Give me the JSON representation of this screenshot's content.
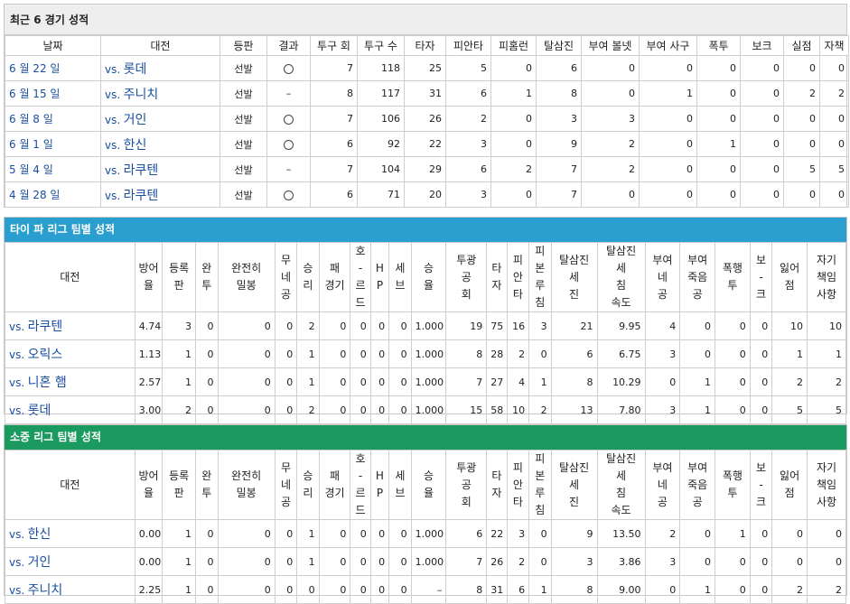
{
  "recent": {
    "title": "최근 6 경기 성적",
    "headers": [
      "날짜",
      "대전",
      "등판",
      "결과",
      "투구 회",
      "투구 수",
      "타자",
      "피안타",
      "피홈런",
      "탈삼진",
      "부여 볼넷",
      "부여 사구",
      "폭투",
      "보크",
      "실점",
      "자책"
    ],
    "rows": [
      {
        "date": "6 월 22 일",
        "vs": "vs.",
        "opp": "롯데",
        "start": "선발",
        "result": "win",
        "ip": "7",
        "np": "118",
        "bf": "25",
        "h": "5",
        "hr": "0",
        "so": "6",
        "bb": "0",
        "hbp": "0",
        "wp": "0",
        "bk": "0",
        "r": "0",
        "er": "0"
      },
      {
        "date": "6 월 15 일",
        "vs": "vs.",
        "opp": "주니치",
        "start": "선발",
        "result": "–",
        "ip": "8",
        "np": "117",
        "bf": "31",
        "h": "6",
        "hr": "1",
        "so": "8",
        "bb": "0",
        "hbp": "1",
        "wp": "0",
        "bk": "0",
        "r": "2",
        "er": "2"
      },
      {
        "date": "6 월 8 일",
        "vs": "vs.",
        "opp": "거인",
        "start": "선발",
        "result": "win",
        "ip": "7",
        "np": "106",
        "bf": "26",
        "h": "2",
        "hr": "0",
        "so": "3",
        "bb": "3",
        "hbp": "0",
        "wp": "0",
        "bk": "0",
        "r": "0",
        "er": "0"
      },
      {
        "date": "6 월 1 일",
        "vs": "vs.",
        "opp": "한신",
        "start": "선발",
        "result": "win",
        "ip": "6",
        "np": "92",
        "bf": "22",
        "h": "3",
        "hr": "0",
        "so": "9",
        "bb": "2",
        "hbp": "0",
        "wp": "1",
        "bk": "0",
        "r": "0",
        "er": "0"
      },
      {
        "date": "5 월 4 일",
        "vs": "vs.",
        "opp": "라쿠텐",
        "start": "선발",
        "result": "–",
        "ip": "7",
        "np": "104",
        "bf": "29",
        "h": "6",
        "hr": "2",
        "so": "7",
        "bb": "2",
        "hbp": "0",
        "wp": "0",
        "bk": "0",
        "r": "5",
        "er": "5"
      },
      {
        "date": "4 월 28 일",
        "vs": "vs.",
        "opp": "라쿠텐",
        "start": "선발",
        "result": "win",
        "ip": "6",
        "np": "71",
        "bf": "20",
        "h": "3",
        "hr": "0",
        "so": "7",
        "bb": "0",
        "hbp": "0",
        "wp": "0",
        "bk": "0",
        "r": "0",
        "er": "0"
      }
    ]
  },
  "team_headers": [
    [
      "대전"
    ],
    [
      "방어",
      "율"
    ],
    [
      "등록",
      "판"
    ],
    [
      "완",
      "투"
    ],
    [
      "완전히",
      "밀봉"
    ],
    [
      "무",
      "네",
      "공"
    ],
    [
      "승",
      "리"
    ],
    [
      "패",
      "경기"
    ],
    [
      "호",
      "-",
      "르",
      "드"
    ],
    [
      "H",
      "P"
    ],
    [
      "세",
      "브"
    ],
    [
      "승",
      "율"
    ],
    [
      "투광",
      "공",
      "회"
    ],
    [
      "타",
      "자"
    ],
    [
      "피",
      "안",
      "타"
    ],
    [
      "피",
      "본",
      "루",
      "침"
    ],
    [
      "탈삼진",
      "세",
      "진"
    ],
    [
      "탈삼진",
      "세",
      "침",
      "속도"
    ],
    [
      "부여",
      "네",
      "공"
    ],
    [
      "부여",
      "죽음",
      "공"
    ],
    [
      "폭행",
      "투"
    ],
    [
      "보",
      "-",
      "크"
    ],
    [
      "잃어",
      "점"
    ],
    [
      "자기",
      "책임",
      "사항"
    ]
  ],
  "pacific": {
    "title": "타이 파 리그 팀별 성적",
    "rows": [
      {
        "vs": "vs.",
        "opp": "라쿠텐",
        "cells": [
          "4.74",
          "3",
          "0",
          "0",
          "0",
          "2",
          "0",
          "0",
          "0",
          "0",
          "1.000",
          "19",
          "75",
          "16",
          "3",
          "21",
          "9.95",
          "4",
          "0",
          "0",
          "0",
          "10",
          "10"
        ]
      },
      {
        "vs": "vs.",
        "opp": "오릭스",
        "cells": [
          "1.13",
          "1",
          "0",
          "0",
          "0",
          "1",
          "0",
          "0",
          "0",
          "0",
          "1.000",
          "8",
          "28",
          "2",
          "0",
          "6",
          "6.75",
          "3",
          "0",
          "0",
          "0",
          "1",
          "1"
        ]
      },
      {
        "vs": "vs.",
        "opp": "니혼 햄",
        "cells": [
          "2.57",
          "1",
          "0",
          "0",
          "0",
          "1",
          "0",
          "0",
          "0",
          "0",
          "1.000",
          "7",
          "27",
          "4",
          "1",
          "8",
          "10.29",
          "0",
          "1",
          "0",
          "0",
          "2",
          "2"
        ]
      },
      {
        "vs": "vs.",
        "opp": "롯데",
        "cells": [
          "3.00",
          "2",
          "0",
          "0",
          "0",
          "2",
          "0",
          "0",
          "0",
          "0",
          "1.000",
          "15",
          "58",
          "10",
          "2",
          "13",
          "7.80",
          "3",
          "1",
          "0",
          "0",
          "5",
          "5"
        ]
      }
    ]
  },
  "central": {
    "title": "소중 리그 팀별 성적",
    "rows": [
      {
        "vs": "vs.",
        "opp": "한신",
        "cells": [
          "0.00",
          "1",
          "0",
          "0",
          "0",
          "1",
          "0",
          "0",
          "0",
          "0",
          "1.000",
          "6",
          "22",
          "3",
          "0",
          "9",
          "13.50",
          "2",
          "0",
          "1",
          "0",
          "0",
          "0"
        ]
      },
      {
        "vs": "vs.",
        "opp": "거인",
        "cells": [
          "0.00",
          "1",
          "0",
          "0",
          "0",
          "1",
          "0",
          "0",
          "0",
          "0",
          "1.000",
          "7",
          "26",
          "2",
          "0",
          "3",
          "3.86",
          "3",
          "0",
          "0",
          "0",
          "0",
          "0"
        ]
      },
      {
        "vs": "vs.",
        "opp": "주니치",
        "cells": [
          "2.25",
          "1",
          "0",
          "0",
          "0",
          "0",
          "0",
          "0",
          "0",
          "0",
          "–",
          "8",
          "31",
          "6",
          "1",
          "8",
          "9.00",
          "0",
          "1",
          "0",
          "0",
          "2",
          "2"
        ]
      }
    ]
  }
}
